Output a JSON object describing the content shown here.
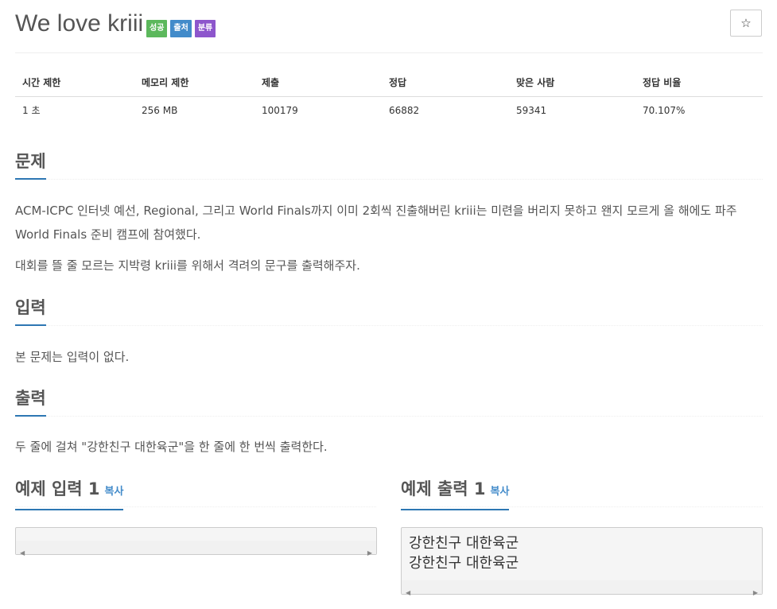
{
  "problem": {
    "title": "We love kriii",
    "labels": [
      "성공",
      "출처",
      "분류"
    ],
    "star_icon": "☆"
  },
  "info_table": {
    "headers": [
      "시간 제한",
      "메모리 제한",
      "제출",
      "정답",
      "맞은 사람",
      "정답 비율"
    ],
    "values": [
      "1 초",
      "256 MB",
      "100179",
      "66882",
      "59341",
      "70.107%"
    ]
  },
  "sections": {
    "description": {
      "title": "문제",
      "paragraphs": [
        "ACM-ICPC 인터넷 예선, Regional, 그리고 World Finals까지 이미 2회씩 진출해버린 kriii는 미련을 버리지 못하고 왠지 모르게 올 해에도 파주",
        "World Finals 준비 캠프에 참여했다.",
        "대회를 뜰 줄 모르는 지박령 kriii를 위해서 격려의 문구를 출력해주자."
      ]
    },
    "input": {
      "title": "입력",
      "text": "본 문제는 입력이 없다."
    },
    "output": {
      "title": "출력",
      "text": "두 줄에 걸쳐 \"강한친구 대한육군\"을 한 줄에 한 번씩 출력한다."
    }
  },
  "samples": {
    "input": {
      "title": "예제 입력 1",
      "copy_label": "복사",
      "lines": []
    },
    "output": {
      "title": "예제 출력 1",
      "copy_label": "복사",
      "lines": [
        "강한친구 대한육군",
        "강한친구 대한육군"
      ]
    }
  },
  "colors": {
    "label_success": "#5cb85c",
    "label_source": "#428bca",
    "label_category": "#8d56cc",
    "section_underline": "#2d77b3",
    "link": "#428bca"
  }
}
